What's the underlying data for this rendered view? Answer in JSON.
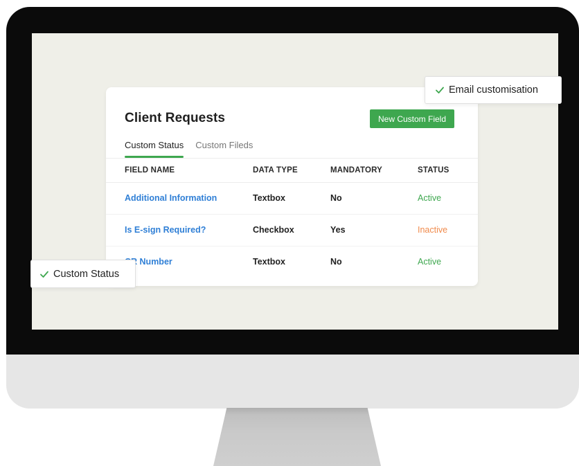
{
  "card": {
    "title": "Client Requests",
    "new_field_button": "New Custom Field",
    "tabs": [
      {
        "label": "Custom Status",
        "active": true
      },
      {
        "label": "Custom Fileds",
        "active": false
      }
    ],
    "table": {
      "headers": [
        "FIELD NAME",
        "DATA TYPE",
        "MANDATORY",
        "STATUS"
      ],
      "rows": [
        {
          "field_name": "Additional Information",
          "data_type": "Textbox",
          "mandatory": "No",
          "status": "Active"
        },
        {
          "field_name": "Is E-sign Required?",
          "data_type": "Checkbox",
          "mandatory": "Yes",
          "status": "Inactive"
        },
        {
          "field_name": "CR Number",
          "data_type": "Textbox",
          "mandatory": "No",
          "status": "Active"
        }
      ]
    }
  },
  "floating_tags": {
    "email": {
      "label": "Email customisation",
      "icon": "check-icon"
    },
    "status": {
      "label": "Custom Status",
      "icon": "check-icon"
    }
  },
  "colors": {
    "accent_green": "#3ea74f",
    "link_blue": "#2f7fd6",
    "inactive_orange": "#f08a4b",
    "screen_bg": "#efefe8",
    "bezel": "#0b0b0b"
  }
}
